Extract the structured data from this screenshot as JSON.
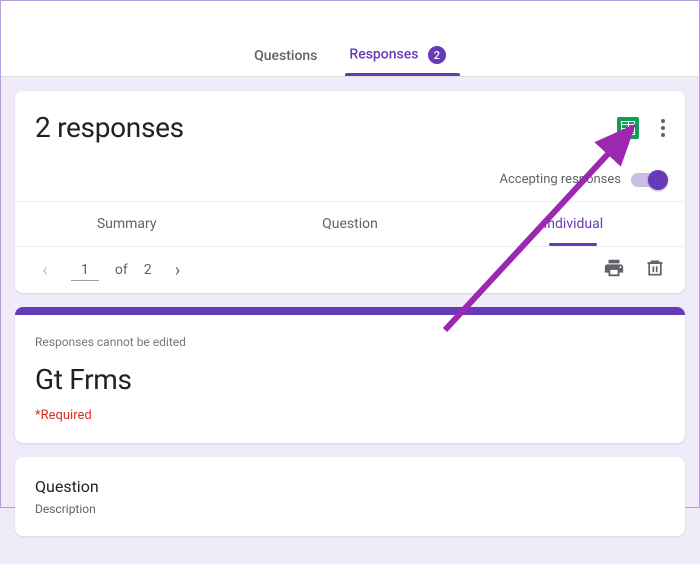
{
  "header": {
    "tabs": {
      "questions": "Questions",
      "responses": "Responses",
      "responses_count": "2"
    }
  },
  "responses": {
    "title": "2 responses",
    "accepting_label": "Accepting responses",
    "inner_tabs": {
      "summary": "Summary",
      "question": "Question",
      "individual": "Individual"
    },
    "pagination": {
      "current": "1",
      "of_label": "of",
      "total": "2"
    }
  },
  "form": {
    "edit_notice": "Responses cannot be edited",
    "title": "Gt Frms",
    "required_label": "*Required"
  },
  "question": {
    "title": "Question",
    "description": "Description"
  }
}
